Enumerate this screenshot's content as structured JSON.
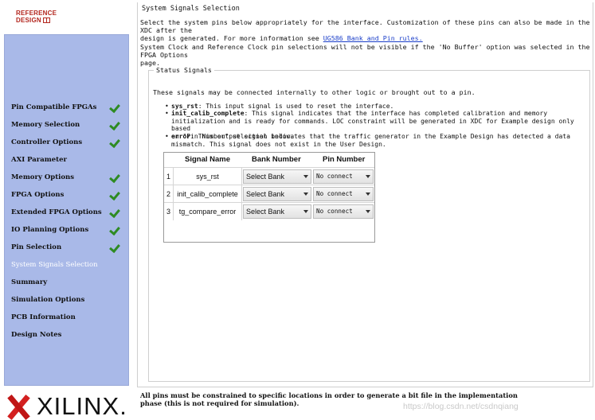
{
  "sidebar": {
    "ref_design_line1": "REFERENCE",
    "ref_design_line2": "DESIGN",
    "items": [
      {
        "label": "Pin Compatible FPGAs",
        "done": true
      },
      {
        "label": "Memory Selection",
        "done": true
      },
      {
        "label": "Controller Options",
        "done": true
      },
      {
        "label": "AXI Parameter",
        "done": false
      },
      {
        "label": "Memory Options",
        "done": true
      },
      {
        "label": "FPGA Options",
        "done": true
      },
      {
        "label": "Extended FPGA Options",
        "done": true
      },
      {
        "label": "IO Planning Options",
        "done": true
      },
      {
        "label": "Pin Selection",
        "done": true
      },
      {
        "label": "System Signals Selection",
        "done": false,
        "active": true
      },
      {
        "label": "Summary",
        "done": false
      },
      {
        "label": "Simulation Options",
        "done": false
      },
      {
        "label": "PCB Information",
        "done": false
      },
      {
        "label": "Design Notes",
        "done": false
      }
    ],
    "brand": "XILINX."
  },
  "main": {
    "section_title": "System Signals Selection",
    "intro_line1": "Select the system pins below appropriately for the interface. Customization of these pins can also be made in the XDC after the",
    "intro_line2_prefix": "design is generated. For more information see ",
    "intro_link": "UG586 Bank and Pin rules.",
    "note_line1": "System Clock and Reference Clock pin selections will not be visible if the 'No Buffer' option was selected in the FPGA Options",
    "note_line2": "page.",
    "status": {
      "legend": "Status Signals",
      "intro": "These signals may be connected internally to other logic or brought out to a pin.",
      "bullets": [
        {
          "name": "sys_rst",
          "text": ": This input signal is used to reset the interface."
        },
        {
          "name": "init_calib_complete",
          "text": ": This signal indicates that the interface has completed calibration and memory",
          "line2": "initialization and is ready for commands. LOC constraint will be generated in XDC for Example design only based",
          "line3": "on \"Pin Number\" selection below."
        },
        {
          "name": "error",
          "text": ": This output signal indicates that the traffic generator in the Example Design has detected a data",
          "line2": "mismatch. This signal does not exist in the User Design."
        }
      ]
    },
    "table": {
      "headers": [
        "Signal Name",
        "Bank Number",
        "Pin Number"
      ],
      "rows": [
        {
          "idx": "1",
          "name": "sys_rst",
          "bank": "Select Bank",
          "pin": "No connect"
        },
        {
          "idx": "2",
          "name": "init_calib_complete",
          "bank": "Select Bank",
          "pin": "No connect"
        },
        {
          "idx": "3",
          "name": "tg_compare_error",
          "bank": "Select Bank",
          "pin": "No connect"
        }
      ]
    },
    "footer_line1": "All pins must be constrained to specific locations in order to generate a bit file in the implementation",
    "footer_line2": "phase (this is not required for simulation)."
  },
  "watermark": "https://blog.csdn.net/csdnqiang",
  "colors": {
    "nav_bg": "#a9b9e8",
    "check": "#2e8b23",
    "brand_red": "#d32020",
    "link": "#1a3ec9"
  }
}
